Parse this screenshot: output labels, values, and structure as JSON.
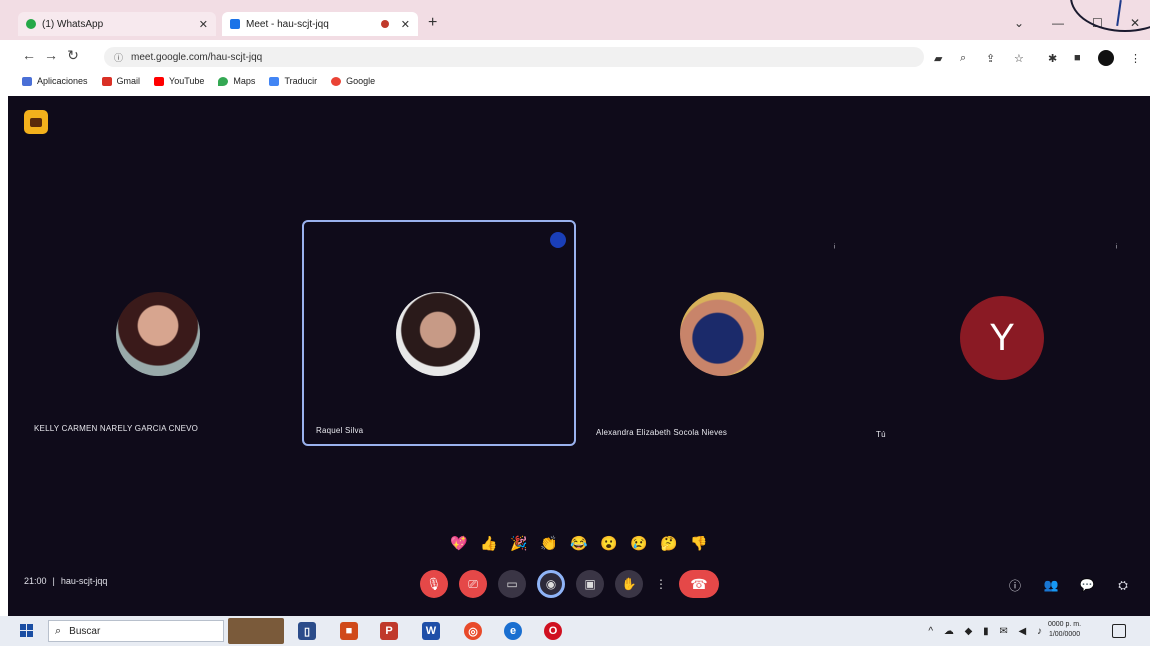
{
  "browser": {
    "tabs": [
      {
        "label": "(1) WhatsApp",
        "color": "#25a848"
      },
      {
        "label": "Meet - hau-scjt-jqq",
        "color": "#1a73e8"
      }
    ],
    "new_tab": "+",
    "url": "meet.google.com/hau-scjt-jqq",
    "bookmarks": [
      {
        "label": "Aplicaciones",
        "color": "#4a6fd6"
      },
      {
        "label": "Gmail",
        "color": "#d93025"
      },
      {
        "label": "YouTube",
        "color": "#ff0000"
      },
      {
        "label": "Maps",
        "color": "#34a853"
      },
      {
        "label": "Traducir",
        "color": "#4285f4"
      },
      {
        "label": "Google",
        "color": "#ea4335"
      }
    ]
  },
  "meeting": {
    "participants": [
      {
        "name": "KELLY CARMEN NARELY GARCIA CNEVO"
      },
      {
        "name": "Raquel Silva"
      },
      {
        "name": "Alexandra Elizabeth Socola Nieves"
      },
      {
        "name": "Tú",
        "initial": "Y"
      }
    ],
    "reactions": [
      "💖",
      "👍",
      "🎉",
      "👏",
      "😂",
      "😮",
      "😢",
      "🤔",
      "👎"
    ],
    "time": "21:00",
    "separator": "|",
    "code": "hau-scjt-jqq",
    "accent_colors": {
      "hangup": "#e54848",
      "active_border": "#9ab2ee",
      "self_avatar": "#8a1a24"
    }
  },
  "taskbar": {
    "search_placeholder": "Buscar",
    "clock_time": "0000 p. m.",
    "clock_date": "1/00/0000"
  }
}
